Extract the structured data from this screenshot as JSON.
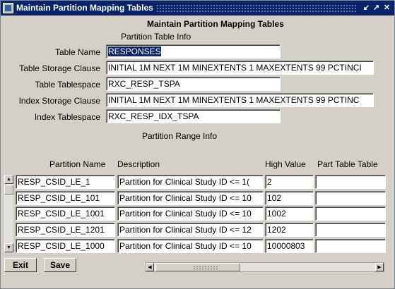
{
  "window": {
    "title": "Maintain Partition Mapping Tables",
    "controls": [
      "↙",
      "↗",
      "✕"
    ]
  },
  "form": {
    "heading": "Maintain Partition Mapping Tables",
    "section_table_info": "Partition Table Info",
    "section_range_info": "Partition Range Info",
    "fields": {
      "table_name": {
        "label": "Table Name",
        "value": "RESPONSES"
      },
      "table_storage_clause": {
        "label": "Table Storage Clause",
        "value": "INITIAL 1M NEXT 1M MINEXTENTS 1 MAXEXTENTS 99 PCTINCI"
      },
      "table_tablespace": {
        "label": "Table Tablespace",
        "value": "RXC_RESP_TSPA"
      },
      "index_storage_clause": {
        "label": "Index Storage Clause",
        "value": "INITIAL 1M NEXT 1M MINEXTENTS 1 MAXEXTENTS 99 PCTINC"
      },
      "index_tablespace": {
        "label": "Index Tablespace",
        "value": "RXC_RESP_IDX_TSPA"
      }
    }
  },
  "grid": {
    "columns": [
      "Partition Name",
      "Description",
      "High Value",
      "Part Table Table"
    ],
    "rows": [
      {
        "name": "RESP_CSID_LE_1",
        "description": "Partition for Clinical Study ID <= 1(",
        "high_value": "2",
        "part_table": ""
      },
      {
        "name": "RESP_CSID_LE_101",
        "description": "Partition for Clinical Study ID <= 10",
        "high_value": "102",
        "part_table": ""
      },
      {
        "name": "RESP_CSID_LE_1001",
        "description": "Partition for Clinical Study ID <= 10",
        "high_value": "1002",
        "part_table": ""
      },
      {
        "name": "RESP_CSID_LE_1201",
        "description": "Partition for Clinical Study ID <= 12",
        "high_value": "1202",
        "part_table": ""
      },
      {
        "name": "RESP_CSID_LE_1000",
        "description": "Partition for Clinical Study ID <= 10",
        "high_value": "10000803",
        "part_table": ""
      }
    ]
  },
  "buttons": {
    "exit": "Exit",
    "save": "Save"
  },
  "icons": {
    "scroll_up": "▲",
    "scroll_down": "▼",
    "scroll_left": "◀",
    "scroll_right": "▶"
  }
}
